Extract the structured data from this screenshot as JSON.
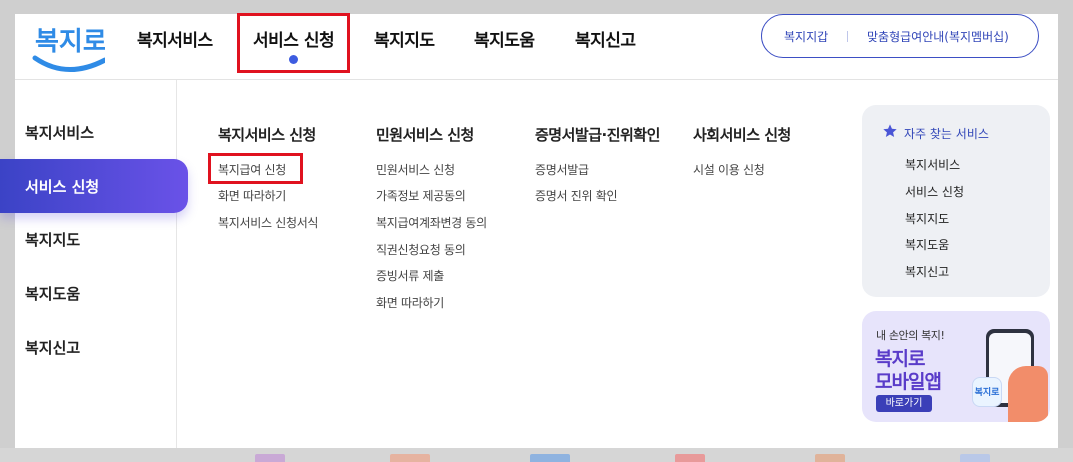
{
  "header": {
    "logo_text": "복지로",
    "nav": [
      "복지서비스",
      "서비스 신청",
      "복지지도",
      "복지도움",
      "복지신고"
    ],
    "active_nav_index": 1,
    "util_links": [
      "복지지갑",
      "맞춤형급여안내(복지멤버십)"
    ]
  },
  "sidebar": {
    "items": [
      "복지서비스",
      "서비스 신청",
      "복지지도",
      "복지도움",
      "복지신고"
    ],
    "active_index": 1
  },
  "menu": {
    "columns": [
      {
        "title": "복지서비스 신청",
        "links": [
          "복지급여 신청",
          "화면 따라하기",
          "복지서비스 신청서식"
        ]
      },
      {
        "title": "민원서비스 신청",
        "links": [
          "민원서비스 신청",
          "가족정보 제공동의",
          "복지급여계좌변경 동의",
          "직권신청요청 동의",
          "증빙서류 제출",
          "화면 따라하기"
        ]
      },
      {
        "title": "증명서발급·진위확인",
        "links": [
          "증명서발급",
          "증명서 진위 확인"
        ]
      },
      {
        "title": "사회서비스 신청",
        "links": [
          "시설 이용 신청"
        ]
      }
    ]
  },
  "frequent": {
    "title": "자주 찾는 서비스",
    "links": [
      "복지서비스",
      "서비스 신청",
      "복지지도",
      "복지도움",
      "복지신고"
    ]
  },
  "banner": {
    "small_text": "내 손안의 복지!",
    "big_line1": "복지로",
    "big_line2": "모바일앱",
    "button": "바로가기",
    "app_icon_text": "복지로"
  },
  "colors": {
    "accent": "#3d5ce0",
    "highlight_red": "#e0121f",
    "sidebar_gradient_start": "#3b43c6",
    "sidebar_gradient_end": "#6a52e8"
  }
}
